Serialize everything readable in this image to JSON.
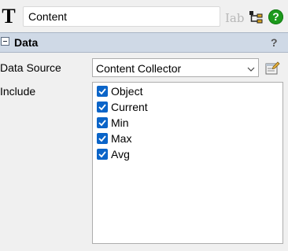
{
  "header": {
    "name_value": "Content",
    "type_glyph": "T",
    "label_icon_text": "Iab",
    "icons": [
      "text-type-icon",
      "label-icon",
      "tree-icon",
      "help-icon"
    ]
  },
  "section": {
    "title": "Data",
    "help_glyph": "?"
  },
  "data_source": {
    "label": "Data Source",
    "selected": "Content Collector"
  },
  "include": {
    "label": "Include",
    "items": [
      {
        "label": "Object",
        "checked": true
      },
      {
        "label": "Current",
        "checked": true
      },
      {
        "label": "Min",
        "checked": true
      },
      {
        "label": "Max",
        "checked": true
      },
      {
        "label": "Avg",
        "checked": true
      }
    ]
  },
  "colors": {
    "section_bar": "#cfd9e6",
    "checkbox": "#0a64c8",
    "help_green": "#1c9a1c"
  }
}
